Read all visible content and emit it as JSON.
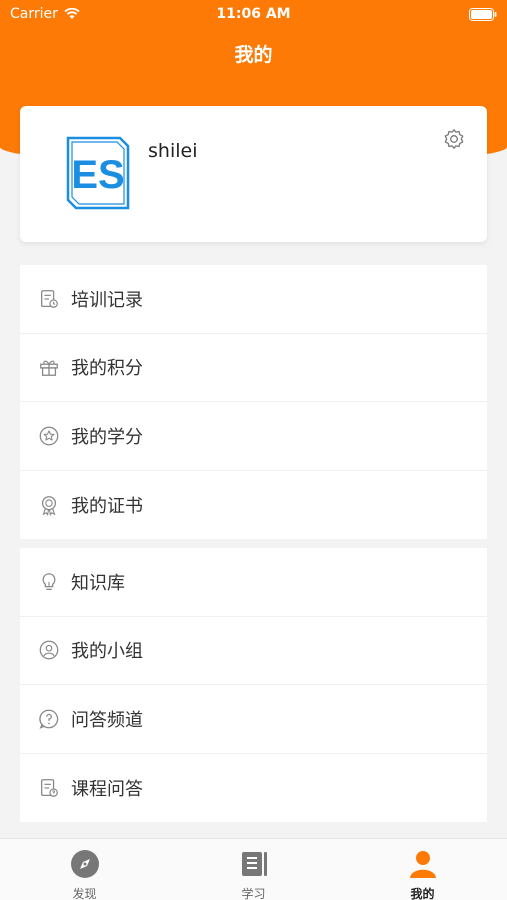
{
  "status_bar": {
    "carrier": "Carrier",
    "time": "11:06 AM"
  },
  "header": {
    "title": "我的"
  },
  "profile": {
    "username": "shilei",
    "avatar_text": "ES"
  },
  "menu_group_1": [
    {
      "label": "培训记录",
      "icon": "training-record-icon"
    },
    {
      "label": "我的积分",
      "icon": "gift-icon"
    },
    {
      "label": "我的学分",
      "icon": "star-icon"
    },
    {
      "label": "我的证书",
      "icon": "certificate-icon"
    }
  ],
  "menu_group_2": [
    {
      "label": "知识库",
      "icon": "lightbulb-icon"
    },
    {
      "label": "我的小组",
      "icon": "group-icon"
    },
    {
      "label": "问答频道",
      "icon": "question-icon"
    },
    {
      "label": "课程问答",
      "icon": "course-qa-icon"
    }
  ],
  "tab_bar": [
    {
      "label": "发现",
      "icon": "compass-icon",
      "active": false
    },
    {
      "label": "学习",
      "icon": "book-icon",
      "active": false
    },
    {
      "label": "我的",
      "icon": "person-icon",
      "active": true
    }
  ],
  "colors": {
    "accent": "#fe7a06",
    "logo_blue": "#1a8ee0"
  }
}
